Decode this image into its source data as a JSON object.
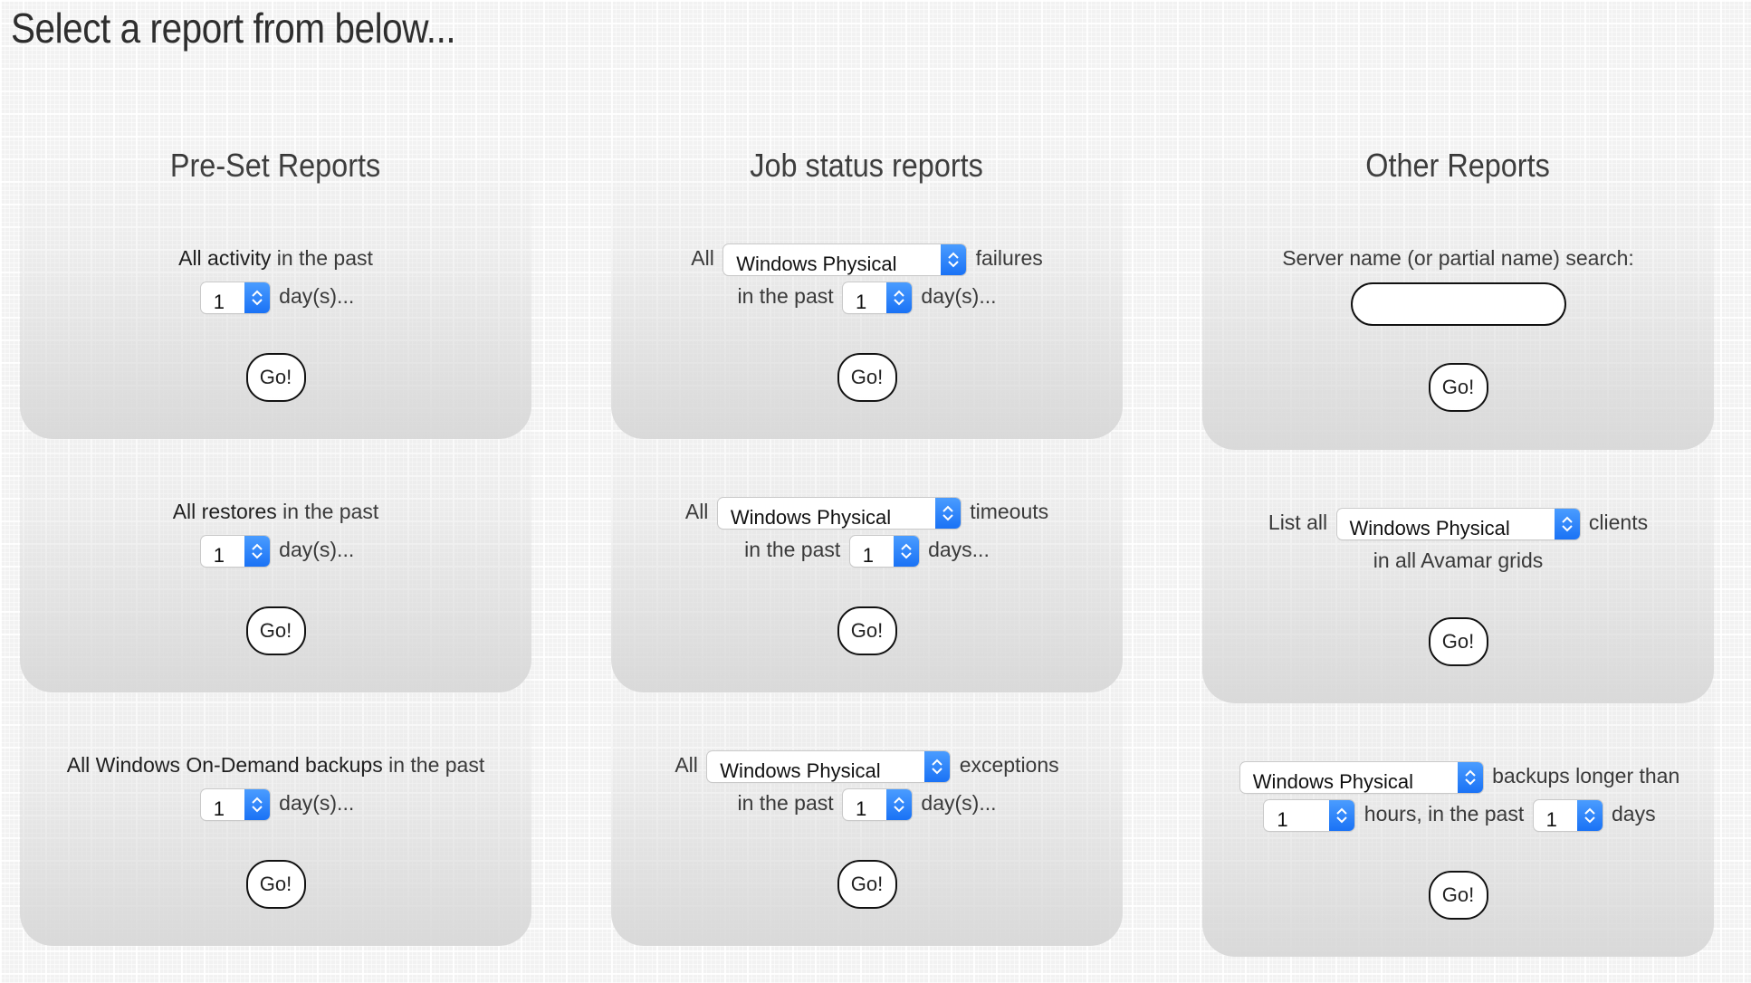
{
  "page": {
    "title": "Select a report from below..."
  },
  "columns": [
    {
      "heading": "Pre-Set Reports"
    },
    {
      "heading": "Job status reports"
    },
    {
      "heading": "Other Reports"
    }
  ],
  "common": {
    "go_label": "Go!"
  },
  "preset": {
    "activity": {
      "lead": "All activity",
      "tail": "in the past",
      "days_value": "1",
      "days_suffix": "day(s)..."
    },
    "restores": {
      "lead": "All restores",
      "tail": "in the past",
      "days_value": "1",
      "days_suffix": "day(s)..."
    },
    "ondemand": {
      "lead": "All Windows On-Demand backups",
      "tail": "in the past",
      "days_value": "1",
      "days_suffix": "day(s)..."
    }
  },
  "jobstatus": {
    "failures": {
      "prefix": "All",
      "type_value": "Windows Physical",
      "suffix": "failures",
      "past_label": "in the past",
      "days_value": "1",
      "days_suffix": "day(s)..."
    },
    "timeouts": {
      "prefix": "All",
      "type_value": "Windows Physical",
      "suffix": "timeouts",
      "past_label": "in the past",
      "days_value": "1",
      "days_suffix": "days..."
    },
    "exceptions": {
      "prefix": "All",
      "type_value": "Windows Physical",
      "suffix": "exceptions",
      "past_label": "in the past",
      "days_value": "1",
      "days_suffix": "day(s)..."
    }
  },
  "other": {
    "search": {
      "label": "Server name (or partial name) search:",
      "value": "",
      "placeholder": ""
    },
    "clients": {
      "prefix": "List all",
      "type_value": "Windows Physical",
      "suffix": "clients",
      "line2": "in all Avamar grids"
    },
    "long_backups": {
      "type_value": "Windows Physical",
      "suffix": "backups longer than",
      "hours_value": "1",
      "hours_suffix": "hours, in the past",
      "days_value": "1",
      "days_suffix": "days"
    }
  },
  "icons": {
    "select_arrow": "up-down-chevron-icon"
  },
  "colors": {
    "select_accent": "#1a72f5",
    "card_bottom": "#d6d6d6",
    "text": "#2b2b2b"
  }
}
